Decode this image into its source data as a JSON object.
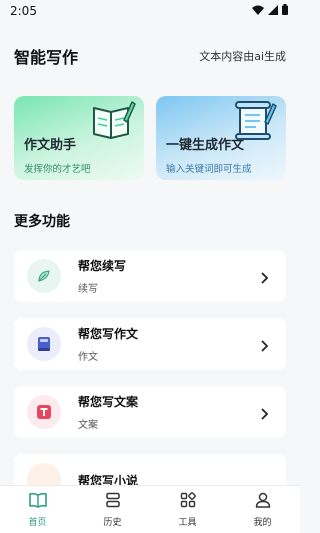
{
  "status_bar": {
    "time": "2:05"
  },
  "header": {
    "title": "智能写作",
    "ai_note": "文本内容由ai生成"
  },
  "cards": [
    {
      "title": "作文助手",
      "subtitle": "发挥你的才艺吧",
      "icon": "notebook-pen-icon"
    },
    {
      "title": "一键生成作文",
      "subtitle": "输入关键词即可生成",
      "icon": "scroll-pen-icon"
    }
  ],
  "section": {
    "title": "更多功能"
  },
  "features": [
    {
      "title": "帮您续写",
      "subtitle": "续写",
      "icon": "feather-icon",
      "color": "#e9f5f1"
    },
    {
      "title": "帮您写作文",
      "subtitle": "作文",
      "icon": "book-icon",
      "color": "#ebeefa"
    },
    {
      "title": "帮您写文案",
      "subtitle": "文案",
      "icon": "text-t-icon",
      "color": "#fdeaee"
    },
    {
      "title": "帮您写小说",
      "subtitle": "",
      "icon": "novel-icon",
      "color": "#fdf0e6"
    }
  ],
  "tabs": [
    {
      "label": "首页",
      "icon": "open-book-icon",
      "active": true
    },
    {
      "label": "历史",
      "icon": "history-icon",
      "active": false
    },
    {
      "label": "工具",
      "icon": "tools-grid-icon",
      "active": false
    },
    {
      "label": "我的",
      "icon": "user-icon",
      "active": false
    }
  ],
  "colors": {
    "accent": "#2f9f7f",
    "background": "#f6f7f9",
    "green_card": "#79e6b3",
    "blue_card": "#7ec6f1"
  }
}
